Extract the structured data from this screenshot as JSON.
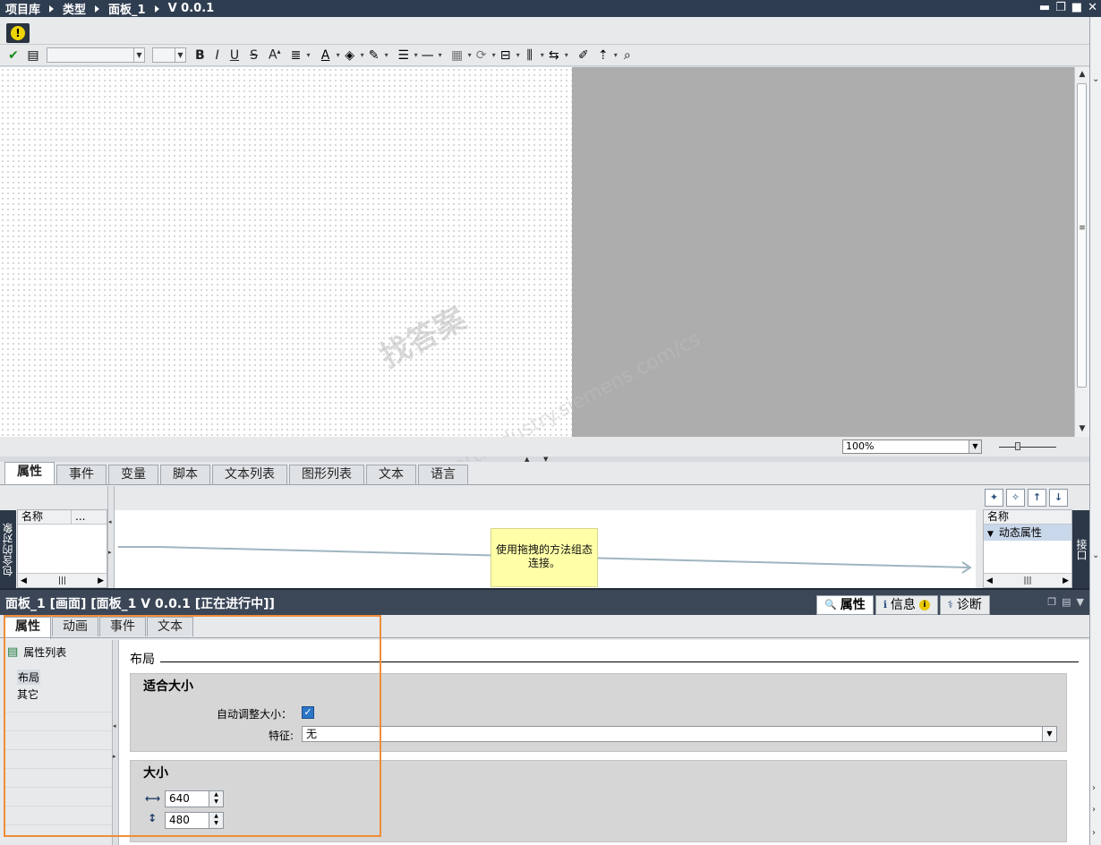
{
  "titlebar": {
    "crumbs": [
      "项目库",
      "类型",
      "面板_1",
      "V 0.0.1"
    ]
  },
  "format_toolbar": {
    "bold": "B",
    "italic": "I",
    "underline": "U",
    "strike": "S",
    "font_size_inc": "A"
  },
  "zoom": {
    "value": "100%"
  },
  "faceplate_tabs": [
    "属性",
    "事件",
    "变量",
    "脚本",
    "文本列表",
    "图形列表",
    "文本",
    "语言"
  ],
  "faceplate_tab_active": 0,
  "contained_objects": {
    "side_label": "包含的对象",
    "col_name": "名称",
    "col_more": "..."
  },
  "connection_note": "使用拖拽的方法组态连接。",
  "interface": {
    "side_label": "接口",
    "col_name": "名称",
    "row_dynamic": "动态属性"
  },
  "inspector": {
    "title": "面板_1 [画面] [面板_1 V 0.0.1 [正在进行中]]",
    "tabs": {
      "properties": "属性",
      "info": "信息",
      "diagnostics": "诊断"
    },
    "prop_tabs": [
      "属性",
      "动画",
      "事件",
      "文本"
    ],
    "prop_list_title": "属性列表",
    "nav_items": [
      "布局",
      "其它"
    ],
    "section": "布局",
    "fit_group": {
      "title": "适合大小",
      "auto_size_label": "自动调整大小：",
      "auto_size_checked": true,
      "feature_label": "特征:",
      "feature_value": "无"
    },
    "size_group": {
      "title": "大小",
      "width": "640",
      "height": "480"
    }
  },
  "watermark": {
    "line1": "找答案",
    "line2": "support.industry.siemens.com/cs"
  },
  "colors": {
    "titlebar": "#2f3d51",
    "highlight_frame": "#ef8d3a",
    "note_bg": "#ffffa8",
    "checkbox": "#2c76c8"
  }
}
